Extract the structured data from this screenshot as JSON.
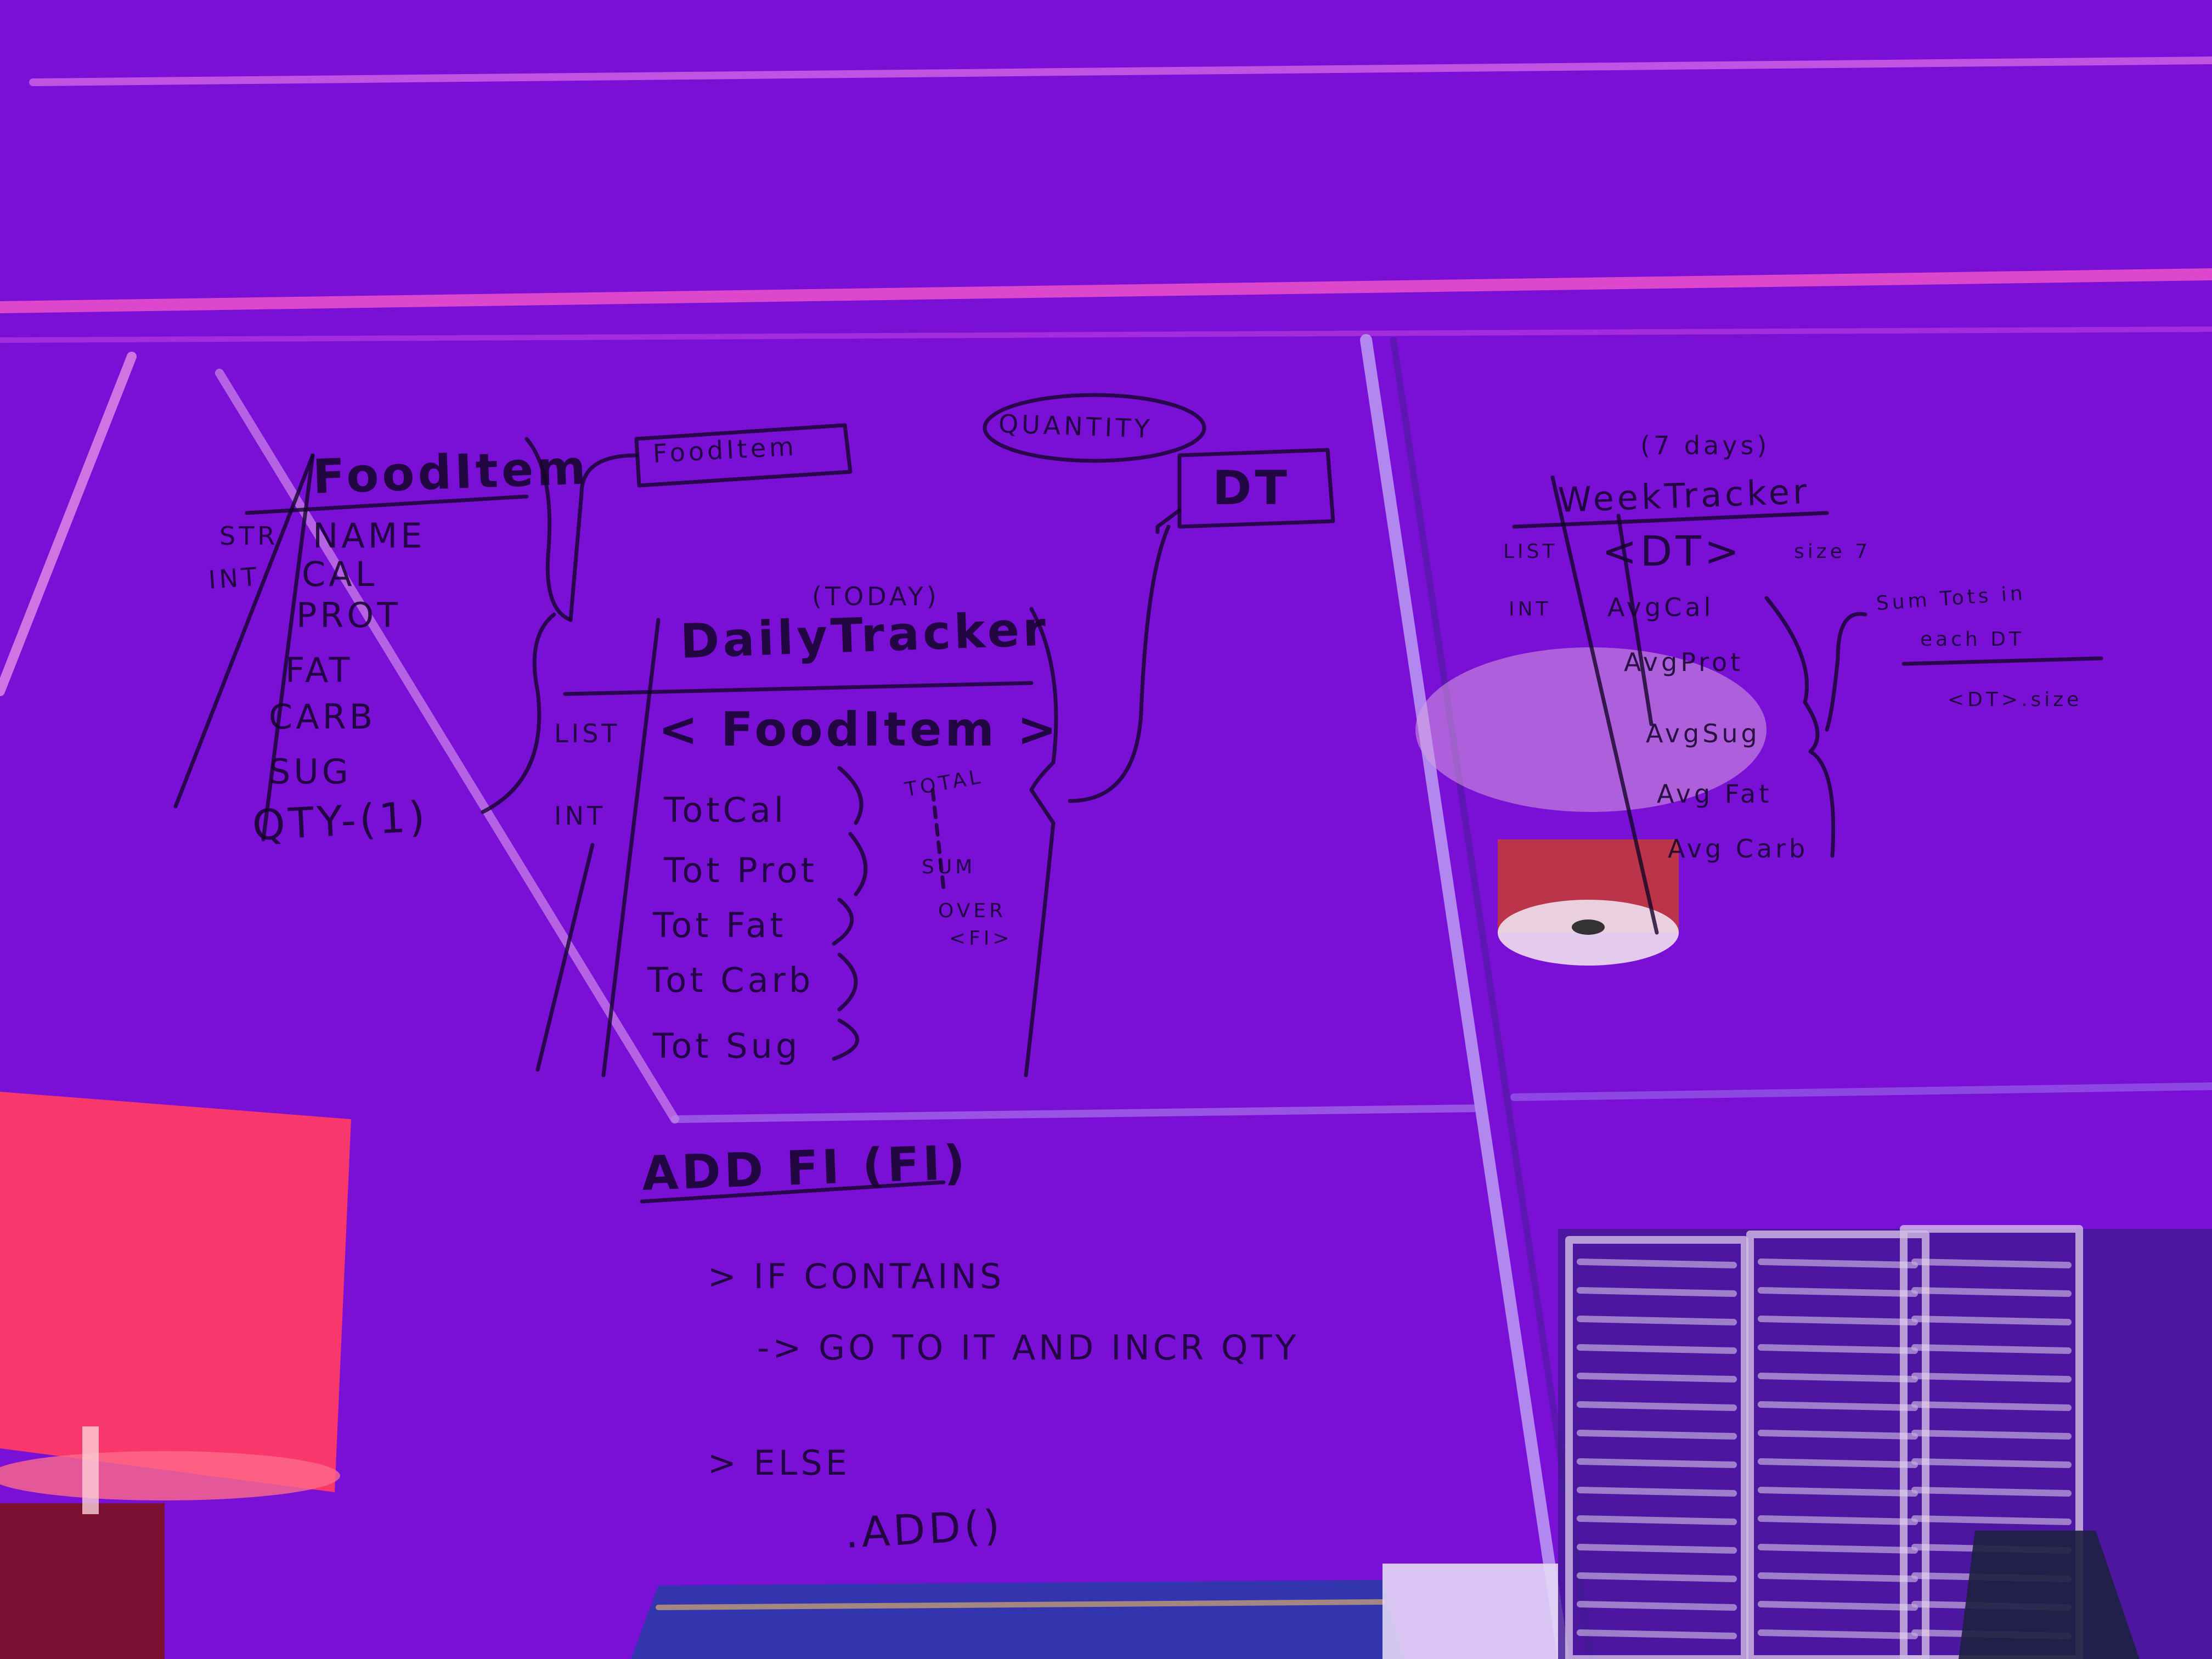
{
  "colors": {
    "wall_magenta": "#d61aa8",
    "wall_violet": "#7a10d6",
    "wall_blue": "#3a18e8",
    "lamp_red": "#ff2a5a",
    "ink": "#14052a",
    "shutter": "#e8dcf2",
    "ceiling_light": "#d8a0e0"
  },
  "board": {
    "fooditem": {
      "title": "FoodItem",
      "type_str": "STR",
      "type_int": "INT",
      "fields": [
        "NAME",
        "CAL",
        "PROT",
        "FAT",
        "CARB",
        "SUG",
        "QTY-(1)"
      ]
    },
    "fooditem_box": "FoodItem",
    "quantity_bubble": "QUANTITY",
    "dt_box": "DT",
    "daily_tracker": {
      "note": "(TODAY)",
      "title": "DailyTracker",
      "type_list": "LIST",
      "list_field": "< FoodItem >",
      "type_int": "INT",
      "int_fields": [
        "TotCal",
        "Tot Prot",
        "Tot Fat",
        "Tot Carb",
        "Tot Sug"
      ],
      "side_notes": [
        "TOTAL",
        "SUM",
        "OVER",
        "<FI>"
      ]
    },
    "weekly_tracker": {
      "note": "(7 days)",
      "title": "WeekTracker",
      "type_list": "LIST",
      "list_field": "<DT>",
      "list_note": "size 7",
      "type_int": "INT",
      "int_fields": [
        "AvgCal",
        "AvgProt",
        "AvgSug",
        "Avg Fat",
        "Avg Carb"
      ],
      "side_notes": [
        "Sum Tots in",
        "each DT",
        "<DT>.size"
      ]
    },
    "method": {
      "signature": "ADD FI (FI)",
      "lines": [
        "> IF CONTAINS",
        "-> GO TO IT AND INCR QTY",
        "> ELSE",
        ".ADD()"
      ]
    }
  }
}
